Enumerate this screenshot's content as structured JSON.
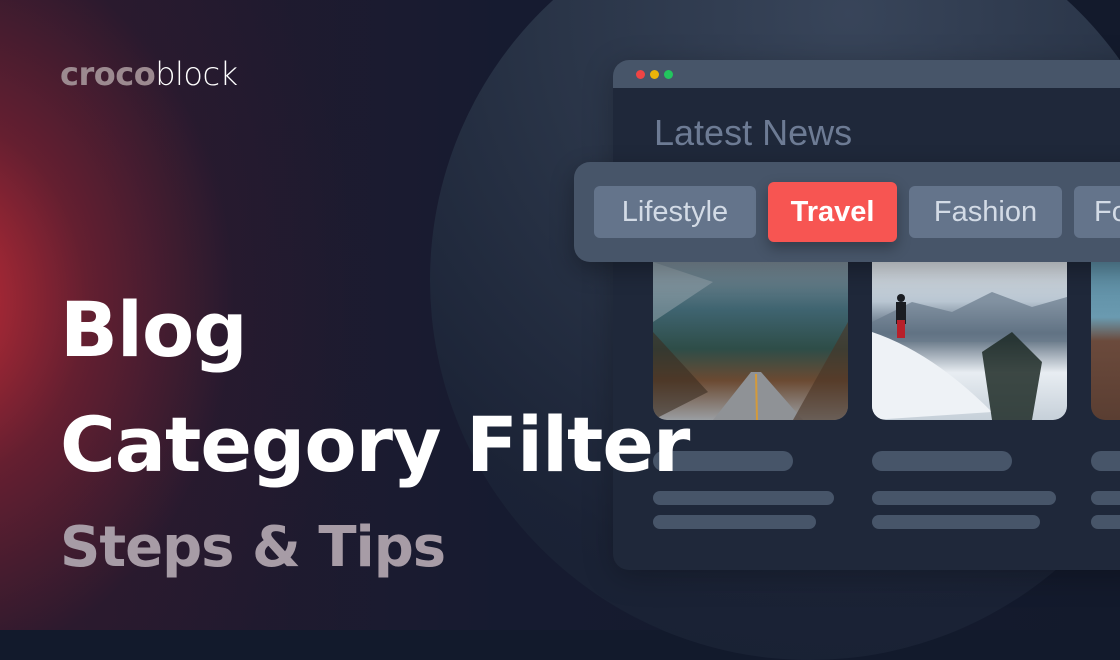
{
  "brand": {
    "part1": "croco",
    "part2": "block"
  },
  "headline": {
    "line1": "Blog",
    "line2": "Category Filter",
    "subtitle": "Steps & Tips"
  },
  "window": {
    "title": "Latest News",
    "traffic_lights": [
      "#ef4444",
      "#eab308",
      "#22c55e"
    ]
  },
  "filters": {
    "active": "Travel",
    "items": [
      {
        "label": "Lifestyle",
        "active": false
      },
      {
        "label": "Travel",
        "active": true
      },
      {
        "label": "Fashion",
        "active": false
      },
      {
        "label": "Fo",
        "active": false
      }
    ]
  },
  "cards": [
    {
      "image": "mountain-road-photo"
    },
    {
      "image": "snowy-mountain-hiker-photo"
    },
    {
      "image": "rock-cliff-photo"
    }
  ],
  "colors": {
    "accent": "#f75552",
    "chip": "#64748b",
    "panel": "#475569",
    "window": "#1f283a"
  }
}
